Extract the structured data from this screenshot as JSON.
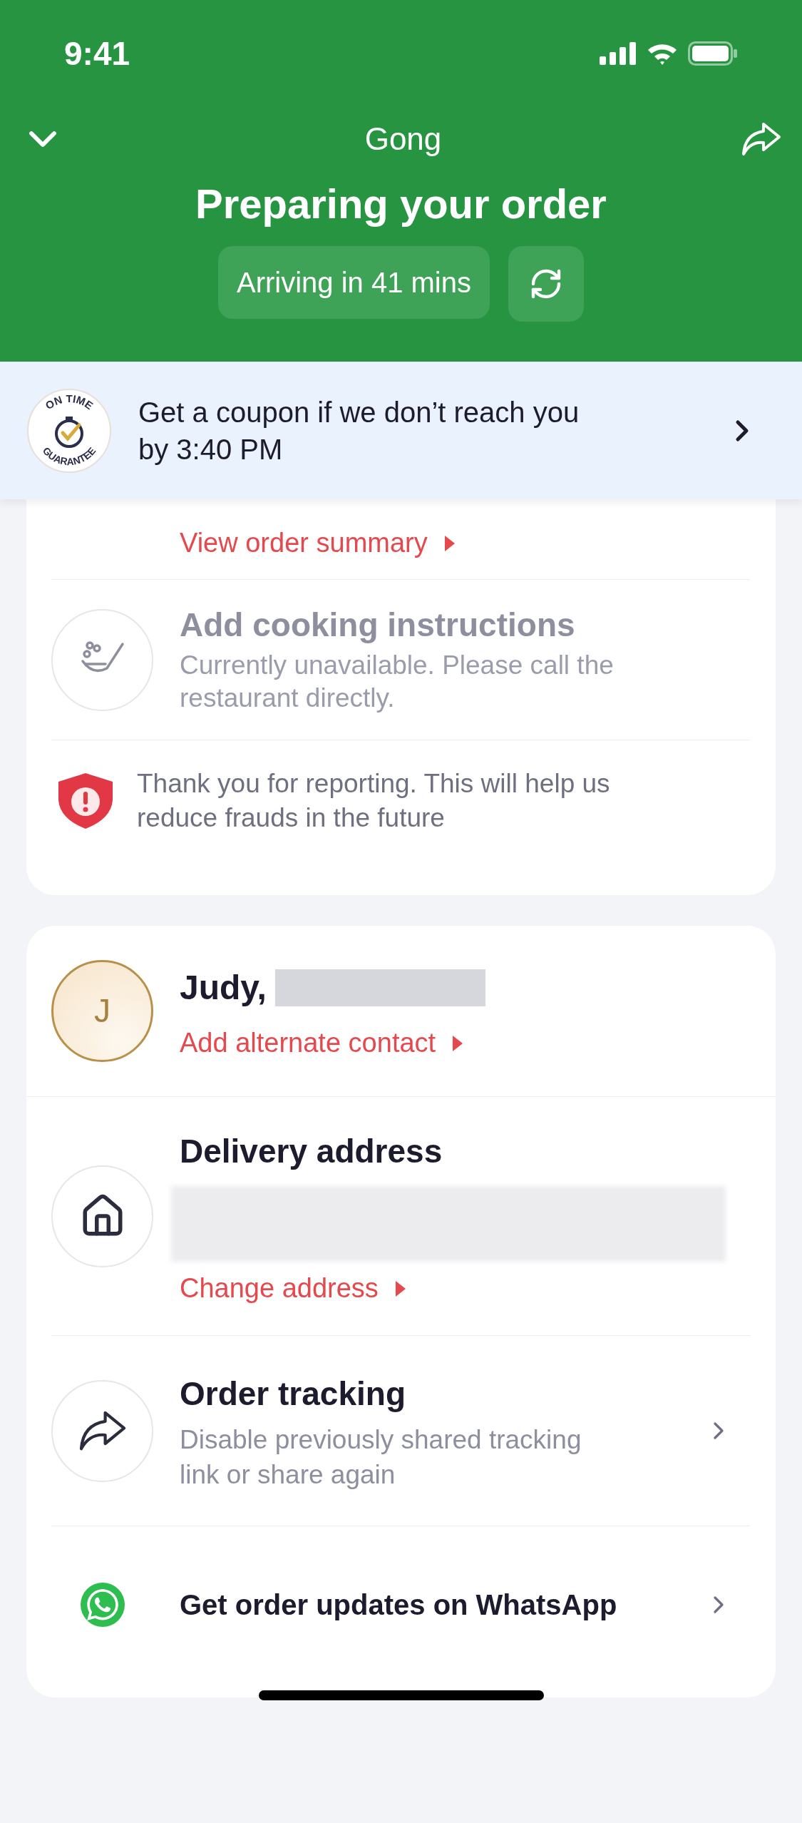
{
  "status_bar": {
    "time": "9:41"
  },
  "header": {
    "restaurant": "Gong",
    "title": "Preparing your order",
    "eta": "Arriving in 41 mins"
  },
  "guarantee_banner": {
    "badge_top": "ON TIME",
    "badge_bottom": "GUARANTEE",
    "text": "Get a coupon if we don’t reach you by 3:40 PM"
  },
  "order_card": {
    "summary_link": "View order summary",
    "cooking": {
      "title": "Add cooking instructions",
      "subtitle": "Currently unavailable. Please call the restaurant directly.",
      "disabled": true
    },
    "report_note": "Thank you for reporting. This will help us reduce frauds in the future"
  },
  "contact_card": {
    "avatar_initial": "J",
    "name": "Judy,",
    "contact_link": "Add alternate contact",
    "address_title": "Delivery address",
    "address_link": "Change address",
    "tracking_title": "Order tracking",
    "tracking_subtitle": "Disable previously shared tracking link or share again",
    "whatsapp_label": "Get order updates on WhatsApp"
  }
}
